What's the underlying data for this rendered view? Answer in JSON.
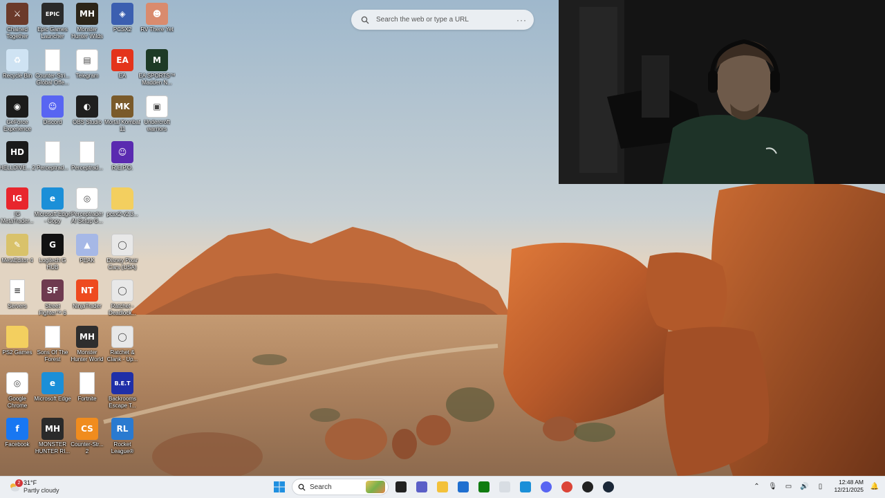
{
  "desktop": {
    "icons": [
      {
        "label": "Chained Together",
        "icon": "chained-together-icon",
        "color": "#6b3a2a",
        "glyph": "⚔"
      },
      {
        "label": "Epic Games Launcher",
        "icon": "epic-games-icon",
        "color": "#2a2a2a",
        "glyph": "EPIC"
      },
      {
        "label": "Monster Hunter Wilds",
        "icon": "monster-hunter-wilds-icon",
        "color": "#2b2418",
        "glyph": "MH"
      },
      {
        "label": "PCSX2",
        "icon": "pcsx2-icon",
        "color": "#3b5fb0",
        "glyph": "◈"
      },
      {
        "label": "RV There Yet",
        "icon": "rv-there-yet-icon",
        "color": "#d98b6e",
        "glyph": "☻"
      },
      {
        "label": "Recycle Bin",
        "icon": "recycle-bin-icon",
        "color": "#cfe3f3",
        "glyph": "♻"
      },
      {
        "label": "Counter-Stri... Global Offe...",
        "icon": "file-icon",
        "color": "#ffffff",
        "glyph": ""
      },
      {
        "label": "Telegram",
        "icon": "telegram-icon",
        "color": "#ffffff",
        "glyph": "▤"
      },
      {
        "label": "EA",
        "icon": "ea-icon",
        "color": "#e4341b",
        "glyph": "EA"
      },
      {
        "label": "EA SPORTS™ Madden N...",
        "icon": "madden-icon",
        "color": "#1d3a26",
        "glyph": "M"
      },
      {
        "label": "GeForce Experience",
        "icon": "geforce-icon",
        "color": "#1b1b1b",
        "glyph": "◉"
      },
      {
        "label": "Discord",
        "icon": "discord-icon",
        "color": "#5865f2",
        "glyph": "☺"
      },
      {
        "label": "OBS Studio",
        "icon": "obs-icon",
        "color": "#1f1f1f",
        "glyph": "◐"
      },
      {
        "label": "Mortal Kombat 11",
        "icon": "mortal-kombat-icon",
        "color": "#7a5a2a",
        "glyph": "MK"
      },
      {
        "label": "Undercroft warriors",
        "icon": "undercroft-icon",
        "color": "#ffffff",
        "glyph": "▣"
      },
      {
        "label": "HELLDIVE... 2",
        "icon": "helldivers-icon",
        "color": "#1a1a1a",
        "glyph": "HD"
      },
      {
        "label": "Perceptrad...",
        "icon": "file-icon",
        "color": "#ffffff",
        "glyph": ""
      },
      {
        "label": "Perceptrad...",
        "icon": "file-icon",
        "color": "#ffffff",
        "glyph": ""
      },
      {
        "label": "R.E.P.O.",
        "icon": "repo-icon",
        "color": "#5a2ab0",
        "glyph": "☺"
      },
      {
        "label": "",
        "icon": "empty-slot",
        "color": "transparent",
        "glyph": ""
      },
      {
        "label": "IG MetaTrader...",
        "icon": "ig-icon",
        "color": "#e8262d",
        "glyph": "IG"
      },
      {
        "label": "Microsoft Edge - Copy",
        "icon": "edge-icon",
        "color": "#1b8fd8",
        "glyph": "e"
      },
      {
        "label": "Perceptrader AI Setup G...",
        "icon": "chrome-file-icon",
        "color": "#ffffff",
        "glyph": "◎"
      },
      {
        "label": "pcsx2-v2.3...",
        "icon": "folder-icon",
        "color": "#f3cf5f",
        "glyph": ""
      },
      {
        "label": "",
        "icon": "empty-slot",
        "color": "transparent",
        "glyph": ""
      },
      {
        "label": "MetaEditor 4",
        "icon": "metaeditor-icon",
        "color": "#d9c26a",
        "glyph": "✎"
      },
      {
        "label": "Logitech G HUB",
        "icon": "logitech-icon",
        "color": "#111111",
        "glyph": "G"
      },
      {
        "label": "PEAK",
        "icon": "peak-icon",
        "color": "#a6b8e6",
        "glyph": "▲"
      },
      {
        "label": "Disney Pixar Cars (USA)",
        "icon": "disc-icon",
        "color": "#e8e8e8",
        "glyph": "◯"
      },
      {
        "label": "",
        "icon": "empty-slot",
        "color": "transparent",
        "glyph": ""
      },
      {
        "label": "Servers",
        "icon": "document-icon",
        "color": "#ffffff",
        "glyph": "≡"
      },
      {
        "label": "Street Fighter™ 6",
        "icon": "street-fighter-icon",
        "color": "#6e3a4f",
        "glyph": "SF"
      },
      {
        "label": "NinjaTrader",
        "icon": "ninjatrader-icon",
        "color": "#ee4a1f",
        "glyph": "NT"
      },
      {
        "label": "Ratchet - Deadlock...",
        "icon": "disc-icon",
        "color": "#e8e8e8",
        "glyph": "◯"
      },
      {
        "label": "",
        "icon": "empty-slot",
        "color": "transparent",
        "glyph": ""
      },
      {
        "label": "PS2 Games",
        "icon": "folder-icon",
        "color": "#f3cf5f",
        "glyph": ""
      },
      {
        "label": "Sons Of The Forest",
        "icon": "file-icon",
        "color": "#ffffff",
        "glyph": ""
      },
      {
        "label": "Monster Hunter World",
        "icon": "monster-hunter-world-icon",
        "color": "#2e2e2e",
        "glyph": "MH"
      },
      {
        "label": "Ratchet & Clank - Up...",
        "icon": "disc-icon",
        "color": "#e8e8e8",
        "glyph": "◯"
      },
      {
        "label": "",
        "icon": "empty-slot",
        "color": "transparent",
        "glyph": ""
      },
      {
        "label": "Google Chrome",
        "icon": "chrome-icon",
        "color": "#ffffff",
        "glyph": "◎"
      },
      {
        "label": "Microsoft Edge",
        "icon": "edge-icon",
        "color": "#1b8fd8",
        "glyph": "e"
      },
      {
        "label": "Fortnite",
        "icon": "file-icon",
        "color": "#ffffff",
        "glyph": ""
      },
      {
        "label": "Backrooms Escape T...",
        "icon": "backrooms-icon",
        "color": "#1f2fa8",
        "glyph": "B.E.T"
      },
      {
        "label": "",
        "icon": "empty-slot",
        "color": "transparent",
        "glyph": ""
      },
      {
        "label": "Facebook",
        "icon": "facebook-icon",
        "color": "#1877f2",
        "glyph": "f"
      },
      {
        "label": "MONSTER HUNTER RI...",
        "icon": "monster-hunter-rise-icon",
        "color": "#2a2a2a",
        "glyph": "MH"
      },
      {
        "label": "Counter-Str... 2",
        "icon": "counter-strike-icon",
        "color": "#f08c1e",
        "glyph": "CS"
      },
      {
        "label": "Rocket League®",
        "icon": "rocket-league-icon",
        "color": "#2a7ad0",
        "glyph": "RL"
      }
    ]
  },
  "browser_search": {
    "placeholder": "Search the web or type a URL",
    "more_label": "···"
  },
  "taskbar": {
    "weather": {
      "temp": "31°F",
      "condition": "Partly cloudy",
      "badge": "2"
    },
    "search_label": "Search",
    "apps": [
      {
        "name": "start-button",
        "color": "#0078d4"
      },
      {
        "name": "task-view-button",
        "color": "#222222"
      },
      {
        "name": "teams-icon",
        "color": "#5b5fc7"
      },
      {
        "name": "file-explorer-icon",
        "color": "#f3c13a"
      },
      {
        "name": "store-icon",
        "color": "#1f6fd0"
      },
      {
        "name": "xbox-icon",
        "color": "#107c10"
      },
      {
        "name": "notepad-icon",
        "color": "#d8dde3"
      },
      {
        "name": "remote-desktop-icon",
        "color": "#1b8fd8"
      },
      {
        "name": "discord-taskbar-icon",
        "color": "#5865f2"
      },
      {
        "name": "chrome-taskbar-icon",
        "color": "#db4437"
      },
      {
        "name": "obs-taskbar-icon",
        "color": "#222222"
      },
      {
        "name": "steam-taskbar-icon",
        "color": "#1b2838"
      }
    ],
    "clock": {
      "time": "12:48 AM",
      "date": "12/21/2025"
    }
  }
}
